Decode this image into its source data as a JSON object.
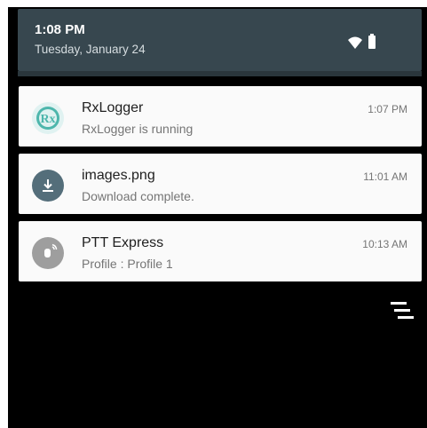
{
  "status": {
    "time": "1:08 PM",
    "date": "Tuesday, January 24"
  },
  "notifications": [
    {
      "app": "RxLogger",
      "title": "RxLogger",
      "text": "RxLogger is running",
      "time": "1:07 PM",
      "icon": "rxlogger-icon",
      "color": "#4db6ac"
    },
    {
      "app": "Downloads",
      "title": "images.png",
      "text": "Download complete.",
      "time": "11:01 AM",
      "icon": "download-icon",
      "color": "#546e7a"
    },
    {
      "app": "PTT Express",
      "title": "PTT Express",
      "text": "Profile : Profile 1",
      "time": "10:13 AM",
      "icon": "ptt-express-icon",
      "color": "#9e9e9e"
    }
  ],
  "controls": {
    "clear_all_icon": "clear-all-icon"
  }
}
